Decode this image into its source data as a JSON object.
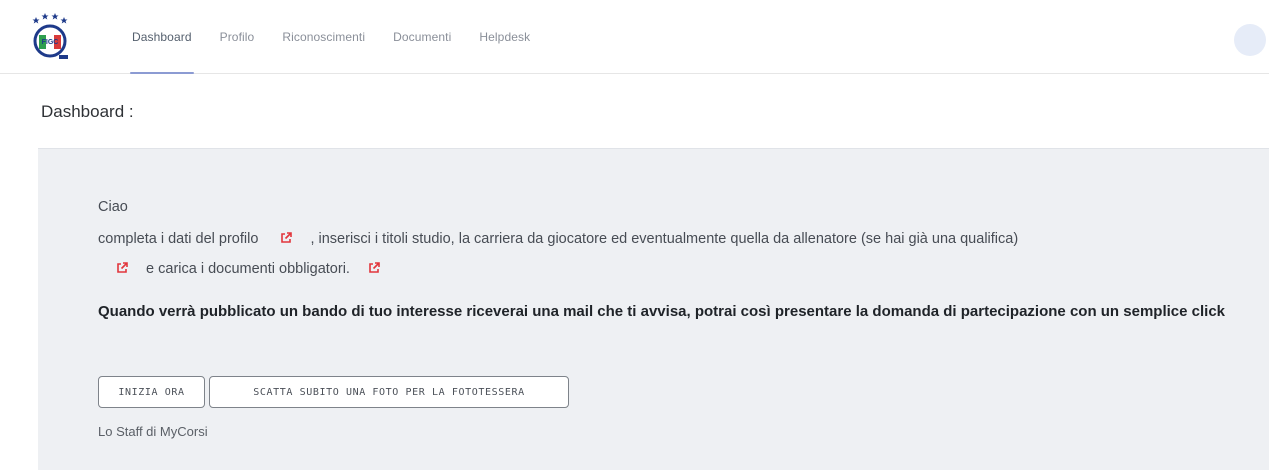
{
  "nav": {
    "items": [
      {
        "label": "Dashboard",
        "active": true
      },
      {
        "label": "Profilo",
        "active": false
      },
      {
        "label": "Riconoscimenti",
        "active": false
      },
      {
        "label": "Documenti",
        "active": false
      },
      {
        "label": "Helpdesk",
        "active": false
      }
    ]
  },
  "page": {
    "title": "Dashboard :"
  },
  "welcome": {
    "greeting": "Ciao",
    "line1_a": "completa i dati del profilo",
    "line1_b": ", inserisci i titoli studio, la carriera da giocatore ed eventualmente quella da allenatore (se hai già una qualifica)",
    "line2": "e carica i documenti obbligatori.",
    "notice": "Quando verrà pubblicato un bando di tuo interesse riceverai una mail che ti avvisa, potrai così presentare la domanda di partecipazione con un semplice click",
    "button_start": "INIZIA ORA",
    "button_photo": "SCATTA SUBITO UNA FOTO PER LA FOTOTESSERA",
    "signature": "Lo Staff di MyCorsi"
  },
  "logo": {
    "text": "FIGC"
  },
  "colors": {
    "accent": "#8c9bd3",
    "external_link_icon": "#e2363c",
    "panel_bg": "#eef0f3"
  },
  "icons": [
    "figc-logo",
    "external-link-icon",
    "user-avatar"
  ]
}
